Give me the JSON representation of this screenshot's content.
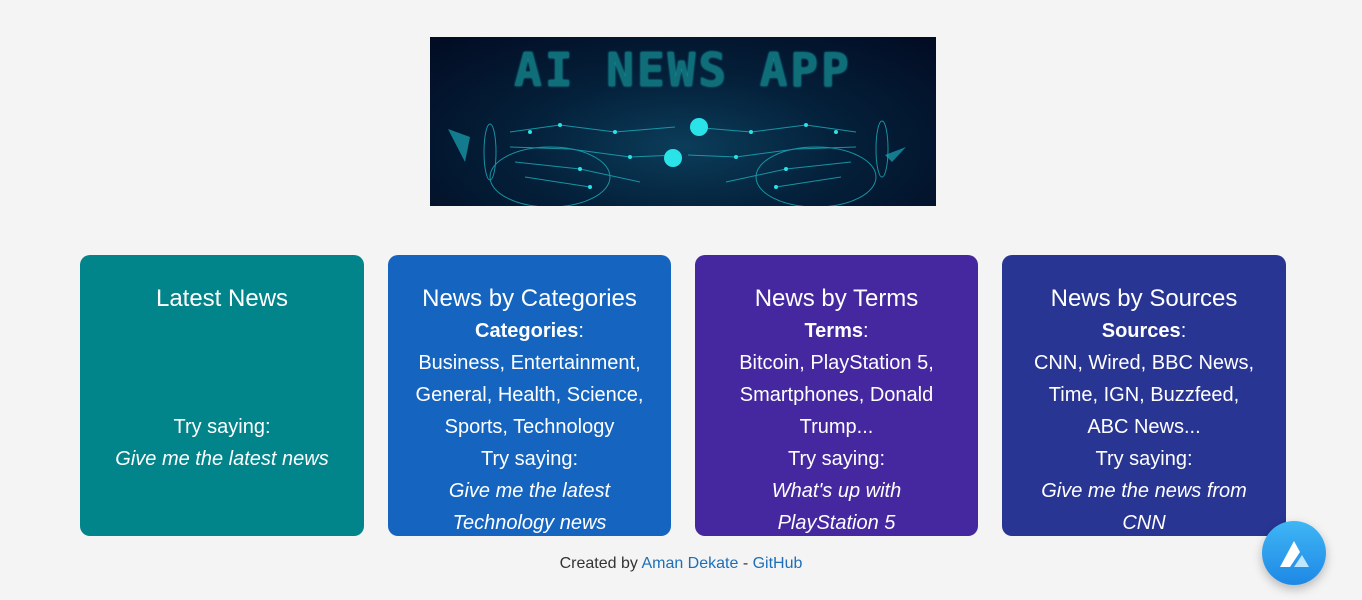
{
  "banner": {
    "title": "AI NEWS APP"
  },
  "cards": [
    {
      "title": "Latest News",
      "try_label": "Try saying:",
      "example": "Give me the latest news"
    },
    {
      "title": "News by Categories",
      "info_label": "Categories",
      "info_colon": ":",
      "info_lines": [
        "Business, Entertainment,",
        "General, Health, Science,",
        "Sports, Technology"
      ],
      "try_label": "Try saying:",
      "example_lines": [
        "Give me the latest",
        "Technology news"
      ]
    },
    {
      "title": "News by Terms",
      "info_label": "Terms",
      "info_colon": ":",
      "info_lines": [
        "Bitcoin, PlayStation 5,",
        "Smartphones, Donald",
        "Trump..."
      ],
      "try_label": "Try saying:",
      "example_lines": [
        "What's up with",
        "PlayStation 5"
      ]
    },
    {
      "title": "News by Sources",
      "info_label": "Sources",
      "info_colon": ":",
      "info_lines": [
        "CNN, Wired, BBC News,",
        "Time, IGN, Buzzfeed,",
        "ABC News..."
      ],
      "try_label": "Try saying:",
      "example_lines": [
        "Give me the news from",
        "CNN"
      ]
    }
  ],
  "footer": {
    "prefix": "Created by ",
    "author": "Aman Dekate",
    "sep": " - ",
    "github": "GitHub"
  },
  "assistant_button": {
    "icon": "alan-logo-icon"
  }
}
